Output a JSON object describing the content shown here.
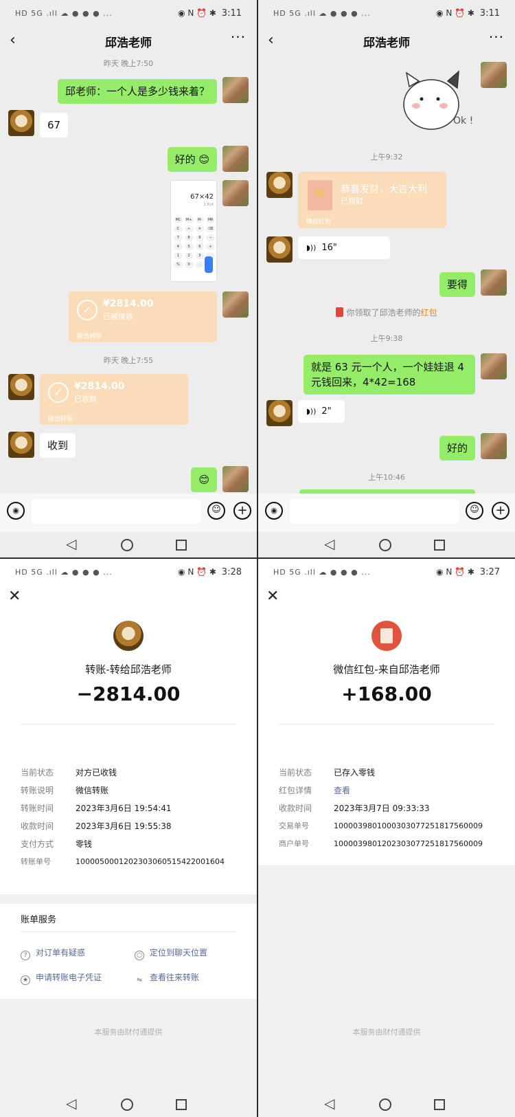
{
  "status": {
    "left_icons": "HD 5G .ıll ☁ ● ● ● ...",
    "right_icons": "◉ N ⏰ ✱",
    "time_1": "3:11",
    "time_2": "3:11",
    "time_3": "3:28",
    "time_4": "3:27"
  },
  "chat": {
    "title": "邱浩老师",
    "panel1": {
      "ts1": "昨天 晚上7:50",
      "msg_question": "邱老师：一个人是多少钱来着？",
      "msg_67": "67",
      "msg_ok": "好的 😊",
      "calc_display": "67×42",
      "calc_result": "2,814",
      "calc_keys": [
        "MC",
        "M+",
        "M-",
        "MR",
        "C",
        "÷",
        "×",
        "⌫",
        "7",
        "8",
        "9",
        "−",
        "4",
        "5",
        "6",
        "+",
        "1",
        "2",
        "3",
        "",
        "%",
        "0",
        ".",
        ""
      ],
      "transfer_out_amount": "¥2814.00",
      "transfer_out_status": "已被接收",
      "transfer_footer": "微信转账",
      "ts2": "昨天 晚上7:55",
      "transfer_in_amount": "¥2814.00",
      "transfer_in_status": "已收款",
      "msg_received": "收到",
      "msg_smile": "😊"
    },
    "panel2": {
      "sticker_text": "Ok !",
      "ts1": "上午9:32",
      "redpacket_title": "恭喜发财，大吉大利",
      "redpacket_status": "已领取",
      "redpacket_footer": "微信红包",
      "voice1": "16\"",
      "msg_yaode": "要得",
      "sys_prefix": "你领取了邱浩老师的",
      "sys_highlight": "红包",
      "ts2": "上午9:38",
      "msg_long": "就是 63 元一个人，一个娃娃退 4 元钱回来，4*42=168",
      "voice2": "2\"",
      "msg_haode": "好的",
      "ts3": "上午10:46"
    }
  },
  "detail_transfer": {
    "title": "转账-转给邱浩老师",
    "amount": "−2814.00",
    "rows": [
      {
        "label": "当前状态",
        "value": "对方已收钱"
      },
      {
        "label": "转账说明",
        "value": "微信转账"
      },
      {
        "label": "转账时间",
        "value": "2023年3月6日 19:54:41"
      },
      {
        "label": "收款时间",
        "value": "2023年3月6日 19:55:38"
      },
      {
        "label": "支付方式",
        "value": "零钱"
      },
      {
        "label": "转账单号",
        "value": "1000050001202303060515422001604"
      }
    ],
    "service_title": "账单服务",
    "services": [
      "对订单有疑惑",
      "定位到聊天位置",
      "申请转账电子凭证",
      "查看往来转账"
    ],
    "provided_by": "本服务由财付通提供"
  },
  "detail_redpacket": {
    "title": "微信红包-来自邱浩老师",
    "amount": "+168.00",
    "rows": [
      {
        "label": "当前状态",
        "value": "已存入零钱"
      },
      {
        "label": "红包详情",
        "value": "查看"
      },
      {
        "label": "收款时间",
        "value": "2023年3月7日 09:33:33"
      },
      {
        "label": "交易单号",
        "value": "1000039801000303077251817560009"
      },
      {
        "label": "商户单号",
        "value": "1000039801202303077251817560009"
      }
    ],
    "provided_by": "本服务由财付通提供"
  }
}
